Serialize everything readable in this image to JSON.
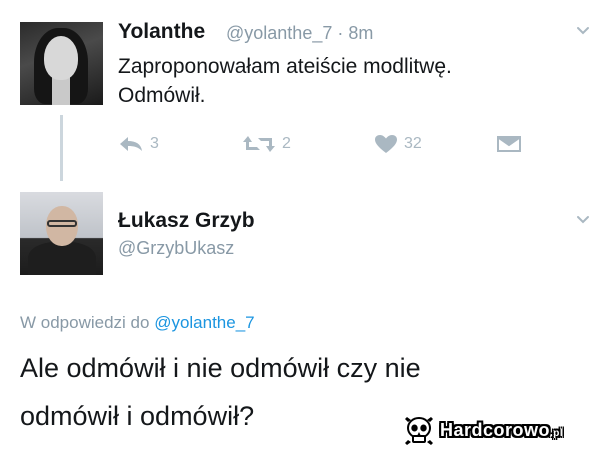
{
  "tweet": {
    "author_name": "Yolanthe",
    "author_handle": "@yolanthe_7 · 8m",
    "text_line1": "Zaproponowałam ateiście modlitwę.",
    "text_line2": "Odmówił.",
    "reply_count": "3",
    "retweet_count": "2",
    "like_count": "32"
  },
  "reply": {
    "author_name": "Łukasz Grzyb",
    "author_handle": "@GrzybUkasz",
    "replying_prefix": "W odpowiedzi do ",
    "replying_mention": "@yolanthe_7",
    "text_line1": "Ale odmówił i nie odmówił czy nie",
    "text_line2": "odmówił i odmówił?"
  },
  "watermark": {
    "brand": "Hardcorowo",
    "suffix": ".pl"
  },
  "icons": [
    "chevron-down-icon",
    "reply-icon",
    "retweet-icon",
    "heart-icon",
    "dm-icon",
    "skull-icon"
  ],
  "colors": {
    "text": "#14171a",
    "secondary": "#8899a6",
    "action_gray": "#aab8c2",
    "mention_blue": "#1b95e0"
  }
}
